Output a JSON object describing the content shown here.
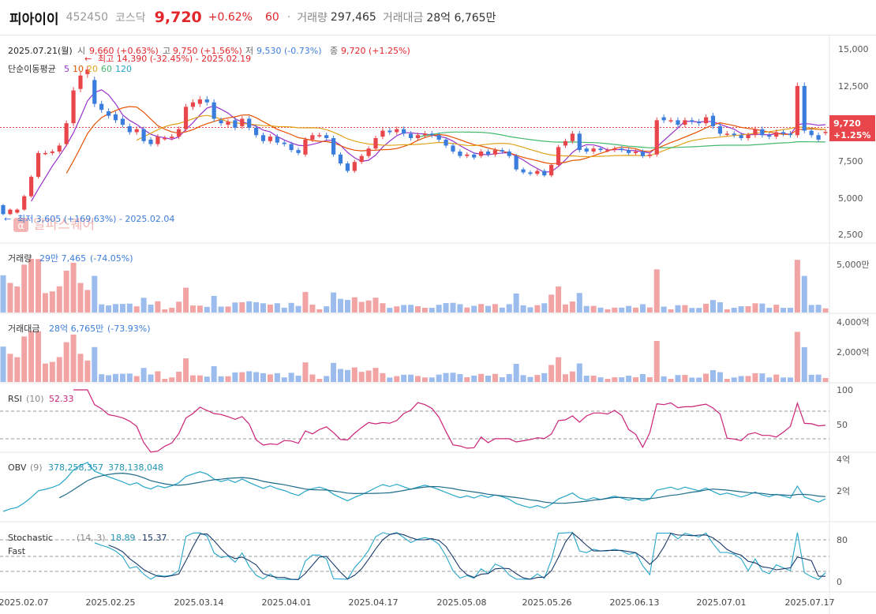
{
  "header": {
    "name": "피아이이",
    "code": "452450",
    "market": "코스닥",
    "price": "9,720",
    "change_pct": "+0.62%",
    "change_abs": "60",
    "separator": "·",
    "volume_label": "거래량",
    "volume_value": "297,465",
    "amount_label": "거래대금",
    "amount_value": "28억 6,765만"
  },
  "colors": {
    "up": "#e8464a",
    "down": "#3b7ddd",
    "up_bar": "#f2a3a4",
    "down_bar": "#9bbcec",
    "ma5": "#9932cc",
    "ma10": "#e65100",
    "ma20": "#e0a21a",
    "ma60": "#43b96d",
    "ma120": "#26a6c9"
  },
  "info_row": {
    "date": "2025.07.21(월)",
    "open_label": "시",
    "open_value": "9,660 (+0.63%)",
    "high_label": "고",
    "high_value": "9,750 (+1.56%)",
    "low_label": "저",
    "low_value": "9,530 (-0.73%)",
    "close_label": "종",
    "close_value": "9,720 (+1.25%)"
  },
  "ma_legend": {
    "label": "단순이동평균",
    "items": [
      "5",
      "10",
      "20",
      "60",
      "120"
    ]
  },
  "annotations": {
    "high": "최고 14,390 (-32.45%) - 2025.02.19",
    "low": "최저 3,605 (+169.63%) - 2025.02.04",
    "watermark": "알파스퀘어",
    "price_tag": "9,720",
    "price_tag_pct": "+1.25%"
  },
  "panels": {
    "volume": {
      "label": "거래량",
      "value": "29만 7,465",
      "pct": "(-74.05%)"
    },
    "amount": {
      "label": "거래대금",
      "value": "28억 6,765만",
      "pct": "(-73.93%)"
    },
    "rsi": {
      "label": "RSI",
      "param": "(10)",
      "value": "52.33"
    },
    "obv": {
      "label": "OBV",
      "param": "(9)",
      "value1": "378,258,357",
      "value2": "378,138,048"
    },
    "stoch": {
      "label1": "Stochastic",
      "label2": "Fast",
      "param": "(14, 3)",
      "value1": "18.89",
      "value2": "15.37"
    }
  },
  "chart_data": [
    {
      "type": "candlestick",
      "title": "피아이이 452450",
      "x_ticks": [
        "2025.02.07",
        "2025.02.25",
        "2025.03.14",
        "2025.04.01",
        "2025.04.17",
        "2025.05.08",
        "2025.05.26",
        "2025.06.13",
        "2025.07.01",
        "2025.07.17"
      ],
      "y_ticks": [
        "15,000",
        "12,500",
        "10,000",
        "7,500",
        "5,000",
        "2,500"
      ],
      "ylim": [
        1650,
        16100
      ],
      "close": [
        4200,
        4500,
        4500,
        5400,
        6700,
        8300,
        8300,
        8400,
        8800,
        10300,
        12500,
        13500,
        13900,
        11600,
        11200,
        10800,
        10500,
        10200,
        9700,
        9900,
        9100,
        8900,
        9400,
        9300,
        9400,
        9900,
        11400,
        11700,
        11900,
        11700,
        10600,
        10300,
        10400,
        10000,
        10600,
        10000,
        9500,
        9100,
        9400,
        9000,
        8900,
        8500,
        8300,
        9200,
        9500,
        9500,
        9300,
        8200,
        7600,
        7100,
        7700,
        8100,
        8600,
        9300,
        9800,
        9700,
        9900,
        9600,
        9300,
        9500,
        9600,
        9500,
        9200,
        8800,
        8400,
        8100,
        8200,
        8000,
        8400,
        8200,
        8500,
        8400,
        8100,
        7200,
        7000,
        6900,
        7100,
        6800,
        7500,
        8700,
        9100,
        9600,
        8500,
        8400,
        8600,
        8500,
        8500,
        8600,
        8500,
        8300,
        8400,
        8100,
        8200,
        10500,
        10500,
        10500,
        10200,
        10500,
        10400,
        10300,
        10700,
        10100,
        9600,
        9600,
        9500,
        9300,
        9500,
        9900,
        9500,
        9400,
        9700,
        9600,
        9500,
        12800,
        9800,
        9500,
        9200,
        9720
      ],
      "open": [
        4800,
        4200,
        4300,
        4500,
        5400,
        6700,
        8300,
        8300,
        8400,
        8900,
        10300,
        12600,
        13600,
        13200,
        11600,
        11100,
        10900,
        10600,
        10100,
        9700,
        9900,
        9200,
        8900,
        9300,
        9300,
        9400,
        9900,
        11400,
        11600,
        11900,
        11700,
        10500,
        10200,
        10500,
        10100,
        10600,
        10000,
        9500,
        9100,
        9400,
        9000,
        8900,
        8500,
        8200,
        9200,
        9500,
        9500,
        9300,
        8200,
        7600,
        7100,
        7700,
        8100,
        8600,
        9400,
        9800,
        9700,
        9900,
        9600,
        9300,
        9500,
        9600,
        9500,
        9200,
        8800,
        8400,
        8100,
        8200,
        8100,
        8400,
        8200,
        8500,
        8400,
        8100,
        7200,
        7000,
        6900,
        7100,
        6800,
        7500,
        8800,
        9100,
        9600,
        8600,
        8400,
        8600,
        8500,
        8500,
        8600,
        8500,
        8300,
        8400,
        8100,
        8200,
        10700,
        10500,
        10500,
        10200,
        10500,
        10400,
        10300,
        10800,
        10100,
        9600,
        9600,
        9500,
        9300,
        9500,
        9900,
        9500,
        9400,
        9700,
        9600,
        9500,
        12800,
        9800,
        9500,
        9660
      ],
      "volume_note": "거래량 / 거래대금 bars follow the same sessions",
      "volume_ticks": [
        "5,000만"
      ],
      "amount_ticks": [
        "4,000억",
        "2,000억"
      ],
      "rsi_ticks": [
        "100",
        "50"
      ],
      "obv_ticks": [
        "4억",
        "2억"
      ],
      "stoch_ticks": [
        "80",
        "0"
      ]
    }
  ]
}
